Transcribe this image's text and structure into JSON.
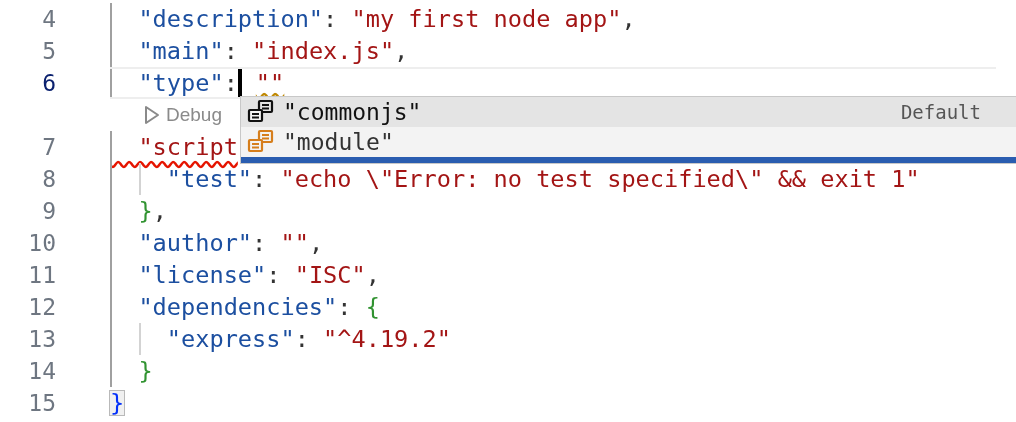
{
  "editor": {
    "lines": [
      {
        "kind": "code",
        "number": "4",
        "current": false,
        "tokens": [
          {
            "kind": "key",
            "text": "  \"description\""
          },
          {
            "kind": "punct",
            "text": ": "
          },
          {
            "kind": "string",
            "text": "\"my first node app\""
          },
          {
            "kind": "punct",
            "text": ","
          }
        ]
      },
      {
        "kind": "code",
        "number": "5",
        "current": false,
        "tokens": [
          {
            "kind": "key",
            "text": "  \"main\""
          },
          {
            "kind": "punct",
            "text": ": "
          },
          {
            "kind": "string",
            "text": "\"index.js\""
          },
          {
            "kind": "punct",
            "text": ","
          }
        ]
      },
      {
        "kind": "code",
        "number": "6",
        "current": true,
        "tokens": [
          {
            "kind": "key",
            "text": "  \"type\""
          },
          {
            "kind": "punct",
            "text": ":"
          },
          {
            "kind": "cursor"
          },
          {
            "kind": "string",
            "text": "\"\"",
            "warning": true
          }
        ]
      },
      {
        "kind": "codelens",
        "label": "Debug"
      },
      {
        "kind": "code",
        "number": "7",
        "current": false,
        "tokens": [
          {
            "kind": "string",
            "text": "  \"script",
            "error": true
          }
        ]
      },
      {
        "kind": "code",
        "number": "8",
        "current": false,
        "tokens": [
          {
            "kind": "key",
            "text": "    \"test\""
          },
          {
            "kind": "punct",
            "text": ": "
          },
          {
            "kind": "string",
            "text": "\"echo \\\"Error: no test specified\\\" && exit 1\""
          }
        ]
      },
      {
        "kind": "code",
        "number": "9",
        "current": false,
        "tokens": [
          {
            "kind": "bracket_inner",
            "text": "  }"
          },
          {
            "kind": "punct",
            "text": ","
          }
        ]
      },
      {
        "kind": "code",
        "number": "10",
        "current": false,
        "tokens": [
          {
            "kind": "key",
            "text": "  \"author\""
          },
          {
            "kind": "punct",
            "text": ": "
          },
          {
            "kind": "string",
            "text": "\"\""
          },
          {
            "kind": "punct",
            "text": ","
          }
        ]
      },
      {
        "kind": "code",
        "number": "11",
        "current": false,
        "tokens": [
          {
            "kind": "key",
            "text": "  \"license\""
          },
          {
            "kind": "punct",
            "text": ": "
          },
          {
            "kind": "string",
            "text": "\"ISC\""
          },
          {
            "kind": "punct",
            "text": ","
          }
        ]
      },
      {
        "kind": "code",
        "number": "12",
        "current": false,
        "tokens": [
          {
            "kind": "key",
            "text": "  \"dependencies\""
          },
          {
            "kind": "punct",
            "text": ": "
          },
          {
            "kind": "bracket_inner",
            "text": "{"
          }
        ]
      },
      {
        "kind": "code",
        "number": "13",
        "current": false,
        "tokens": [
          {
            "kind": "key",
            "text": "    \"express\""
          },
          {
            "kind": "punct",
            "text": ": "
          },
          {
            "kind": "string",
            "text": "\"^4.19.2\""
          }
        ]
      },
      {
        "kind": "code",
        "number": "14",
        "current": false,
        "tokens": [
          {
            "kind": "bracket_inner",
            "text": "  }"
          }
        ]
      },
      {
        "kind": "code",
        "number": "15",
        "current": false,
        "tokens": [
          {
            "kind": "bracket_outer",
            "text": "}",
            "matched": true
          }
        ]
      }
    ]
  },
  "suggestions": {
    "items": [
      {
        "label": "\"commonjs\"",
        "detail": "Default",
        "selected": true
      },
      {
        "label": "\"module\"",
        "selected": false
      }
    ]
  }
}
